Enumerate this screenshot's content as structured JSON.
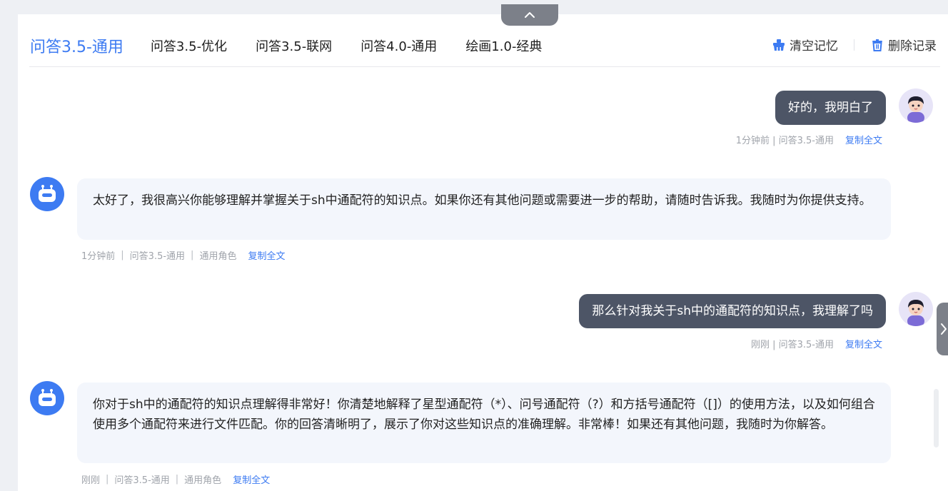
{
  "tabs": [
    {
      "label": "问答3.5-通用",
      "active": true
    },
    {
      "label": "问答3.5-优化",
      "active": false
    },
    {
      "label": "问答3.5-联网",
      "active": false
    },
    {
      "label": "问答4.0-通用",
      "active": false
    },
    {
      "label": "绘画1.0-经典",
      "active": false
    }
  ],
  "header": {
    "clear_memory": "清空记忆",
    "delete_records": "删除记录"
  },
  "messages": [
    {
      "role": "user",
      "text": "好的，我明白了",
      "meta": "1分钟前 | 问答3.5-通用",
      "copy": "复制全文"
    },
    {
      "role": "bot",
      "text": "太好了，我很高兴你能够理解并掌握关于sh中通配符的知识点。如果你还有其他问题或需要进一步的帮助，请随时告诉我。我随时为你提供支持。",
      "meta_time": "1分钟前",
      "meta_model": "问答3.5-通用",
      "meta_role": "通用角色",
      "copy": "复制全文"
    },
    {
      "role": "user",
      "text": "那么针对我关于sh中的通配符的知识点，我理解了吗",
      "meta": "刚刚 | 问答3.5-通用",
      "copy": "复制全文"
    },
    {
      "role": "bot",
      "text": "你对于sh中的通配符的知识点理解得非常好！你清楚地解释了星型通配符（*）、问号通配符（?）和方括号通配符（[]）的使用方法，以及如何组合使用多个通配符来进行文件匹配。你的回答清晰明了，展示了你对这些知识点的准确理解。非常棒！如果还有其他问题，我随时为你解答。",
      "meta_time": "刚刚",
      "meta_model": "问答3.5-通用",
      "meta_role": "通用角色",
      "copy": "复制全文"
    }
  ],
  "colors": {
    "accent": "#3d7bf2",
    "user_bubble": "#4d5566",
    "bot_bubble": "#f3f6fc"
  },
  "icons": [
    "chevron-up-icon",
    "broom-icon",
    "trash-icon",
    "user-avatar-icon",
    "robot-icon",
    "chevron-right-icon"
  ]
}
